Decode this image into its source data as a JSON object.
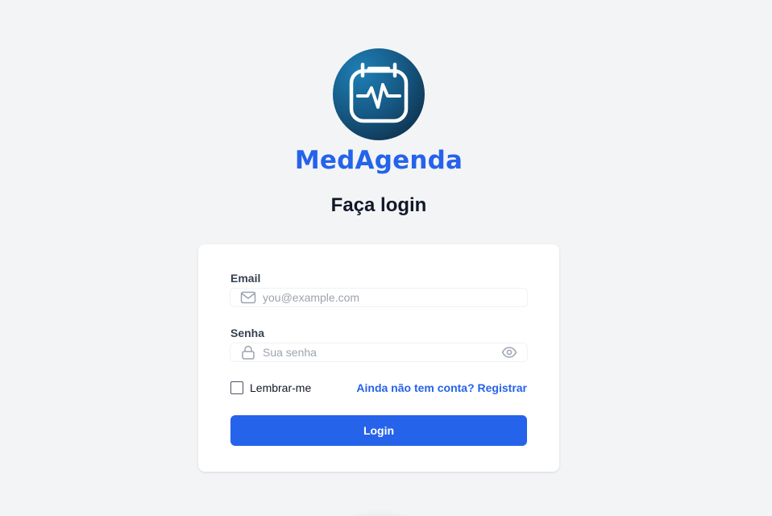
{
  "brand": {
    "name": "MedAgenda",
    "logo_icon": "calendar-heartbeat-icon",
    "color": "#2563eb"
  },
  "page": {
    "heading": "Faça login"
  },
  "form": {
    "email": {
      "label": "Email",
      "placeholder": "you@example.com",
      "value": "",
      "icon": "mail-icon"
    },
    "password": {
      "label": "Senha",
      "placeholder": "Sua senha",
      "value": "",
      "icon": "lock-icon",
      "toggle_icon": "eye-icon"
    },
    "remember": {
      "label": "Lembrar-me",
      "checked": false
    },
    "register_link": "Ainda não tem conta? Registrar",
    "submit_label": "Login"
  },
  "colors": {
    "accent": "#2563eb",
    "background": "#f3f4f6",
    "card": "#ffffff"
  }
}
